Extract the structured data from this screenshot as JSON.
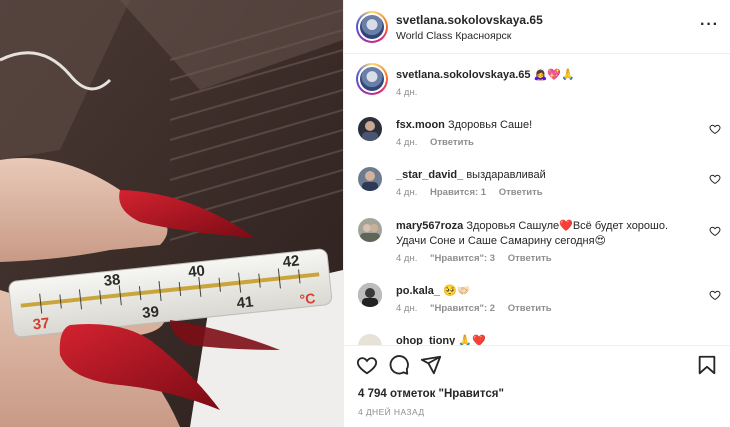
{
  "post": {
    "username": "svetlana.sokolovskaya.65",
    "location": "World Class Красноярск",
    "more_icon": "more-horizontal-icon",
    "thermometer_labels": [
      "38",
      "40",
      "37",
      "39",
      "42",
      "41",
      "°C"
    ]
  },
  "caption": {
    "username": "svetlana.sokolovskaya.65",
    "text": "🙇‍♀️💖🙏",
    "time": "4 дн."
  },
  "comments": [
    {
      "username": "fsx.moon",
      "text": "Здоровья Саше!",
      "time": "4 дн.",
      "likes": "",
      "reply": "Ответить"
    },
    {
      "username": "_star_david_",
      "text": "выздаравливай",
      "time": "4 дн.",
      "likes": "Нравится: 1",
      "reply": "Ответить"
    },
    {
      "username": "mary567roza",
      "text": "Здоровья Сашуле❤️Всё будет хорошо. Удачи Соне и Саше Самарину сегодня😍",
      "time": "4 дн.",
      "likes": "\"Нравится\": 3",
      "reply": "Ответить"
    },
    {
      "username": "po.kala_",
      "text": "🥺🤝🏻",
      "time": "4 дн.",
      "likes": "\"Нравится\": 2",
      "reply": "Ответить"
    },
    {
      "username": "ohop_tiony",
      "text": "🙏❤️",
      "time": "",
      "likes": "",
      "reply": ""
    }
  ],
  "footer": {
    "likes_count": "4 794 отметок \"Нравится\"",
    "posted_ago": "4 ДНЕЙ НАЗАД"
  },
  "colors": {
    "text": "#262626",
    "muted": "#8e8e8e",
    "border": "#efefef"
  }
}
